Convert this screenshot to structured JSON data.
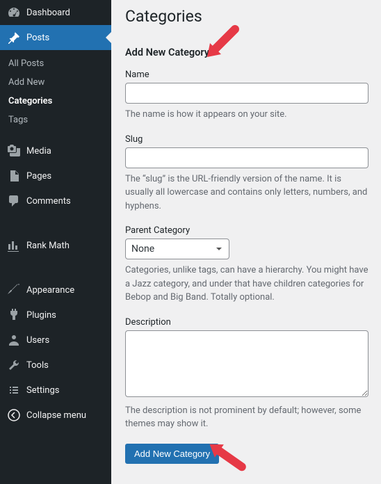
{
  "sidebar": {
    "items": [
      {
        "label": "Dashboard",
        "icon": "dashboard-icon"
      },
      {
        "label": "Posts",
        "icon": "pin-icon",
        "active": true
      },
      {
        "label": "Media",
        "icon": "media-icon"
      },
      {
        "label": "Pages",
        "icon": "pages-icon"
      },
      {
        "label": "Comments",
        "icon": "comments-icon"
      },
      {
        "label": "Rank Math",
        "icon": "chart-icon"
      },
      {
        "label": "Appearance",
        "icon": "brush-icon"
      },
      {
        "label": "Plugins",
        "icon": "plugin-icon"
      },
      {
        "label": "Users",
        "icon": "users-icon"
      },
      {
        "label": "Tools",
        "icon": "tools-icon"
      },
      {
        "label": "Settings",
        "icon": "settings-icon"
      },
      {
        "label": "Collapse menu",
        "icon": "collapse-icon"
      }
    ],
    "submenu": {
      "items": [
        {
          "label": "All Posts"
        },
        {
          "label": "Add New"
        },
        {
          "label": "Categories",
          "current": true
        },
        {
          "label": "Tags"
        }
      ]
    }
  },
  "page": {
    "title": "Categories",
    "section_title": "Add New Category",
    "fields": {
      "name": {
        "label": "Name",
        "help": "The name is how it appears on your site."
      },
      "slug": {
        "label": "Slug",
        "help": "The “slug” is the URL-friendly version of the name. It is usually all lowercase and contains only letters, numbers, and hyphens."
      },
      "parent": {
        "label": "Parent Category",
        "selected": "None",
        "help": "Categories, unlike tags, can have a hierarchy. You might have a Jazz category, and under that have children categories for Bebop and Big Band. Totally optional."
      },
      "description": {
        "label": "Description",
        "help": "The description is not prominent by default; however, some themes may show it."
      }
    },
    "submit_label": "Add New Category"
  }
}
